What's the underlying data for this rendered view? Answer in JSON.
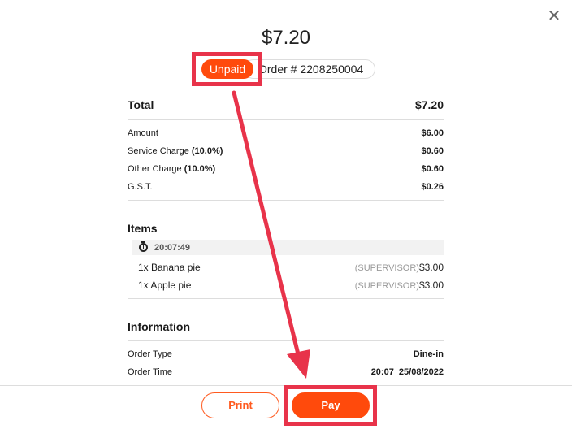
{
  "header": {
    "total_amount": "$7.20",
    "status_badge": "Unpaid",
    "order_label": "Order # 2208250004"
  },
  "summary": {
    "total_label": "Total",
    "total_value": "$7.20",
    "rows": [
      {
        "label": "Amount",
        "pct": "",
        "value": "$6.00"
      },
      {
        "label": "Service Charge ",
        "pct": "(10.0%)",
        "value": "$0.60"
      },
      {
        "label": "Other Charge ",
        "pct": "(10.0%)",
        "value": "$0.60"
      },
      {
        "label": "G.S.T.",
        "pct": "",
        "value": "$0.26"
      }
    ]
  },
  "items": {
    "heading": "Items",
    "time": "20:07:49",
    "list": [
      {
        "name": "1x Banana pie",
        "tag": "(SUPERVISOR)",
        "price": "$3.00"
      },
      {
        "name": "1x Apple pie",
        "tag": "(SUPERVISOR)",
        "price": "$3.00"
      }
    ]
  },
  "information": {
    "heading": "Information",
    "rows": [
      {
        "label": "Order Type",
        "value": "Dine-in"
      },
      {
        "label": "Order Time",
        "value": "20:07  25/08/2022"
      }
    ]
  },
  "footer": {
    "print_label": "Print",
    "pay_label": "Pay"
  },
  "colors": {
    "accent": "#ff4a0c",
    "annotation": "#e8334a"
  },
  "icons": {
    "close": "close-icon",
    "timer": "stopwatch-icon"
  }
}
